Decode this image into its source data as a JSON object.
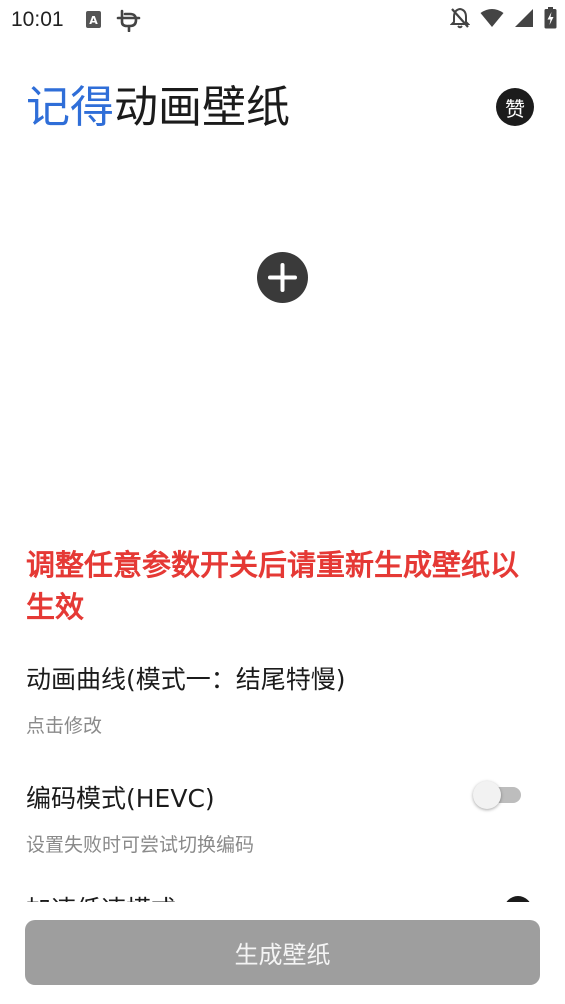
{
  "status_bar": {
    "time": "10:01",
    "icons": [
      "keyboard-a-icon",
      "bug-icon",
      "notifications-off-icon",
      "wifi-icon",
      "cell-signal-icon",
      "battery-charging-icon"
    ],
    "keyboard_letter": "A"
  },
  "header": {
    "title_accent": "记得",
    "title_rest": "动画壁纸",
    "like_label": "赞",
    "accent_color": "#2f6ed8"
  },
  "preview": {
    "add_icon": "plus-circle-icon"
  },
  "warning_text": "调整任意参数开关后请重新生成壁纸以生效",
  "warning_color": "#e53935",
  "settings": [
    {
      "title": "动画曲线(模式一：结尾特慢)",
      "subtitle": "点击修改"
    },
    {
      "title": "编码模式(HEVC)",
      "subtitle": "设置失败时可尝试切换编码",
      "toggle_on": false
    }
  ],
  "partially_visible_setting": {
    "title": "加速低速模式"
  },
  "generate_button": {
    "label": "生成壁纸"
  }
}
